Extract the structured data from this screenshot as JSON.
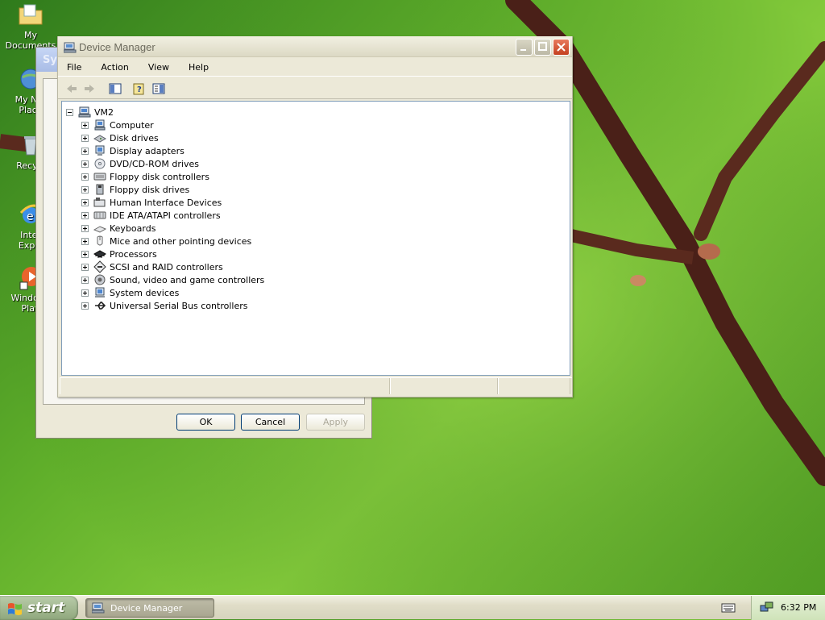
{
  "desktop": {
    "icons": [
      {
        "label": "My Documents"
      },
      {
        "label": "My Net\nPlace"
      },
      {
        "label": "Recycl"
      },
      {
        "label": "Inter\nExplo"
      },
      {
        "label": "Windows\nPlay"
      }
    ]
  },
  "background_window": {
    "title": "Sys",
    "buttons": {
      "ok": "OK",
      "cancel": "Cancel",
      "apply": "Apply"
    }
  },
  "device_manager": {
    "title": "Device Manager",
    "menu": [
      "File",
      "Action",
      "View",
      "Help"
    ],
    "toolbar": [
      "back-icon",
      "forward-icon",
      "show-hide-console-tree-icon",
      "help-icon",
      "properties-icon"
    ],
    "tree": {
      "root": "VM2",
      "items": [
        {
          "label": "Computer",
          "icon": "computer-icon"
        },
        {
          "label": "Disk drives",
          "icon": "disk-drive-icon"
        },
        {
          "label": "Display adapters",
          "icon": "display-adapter-icon"
        },
        {
          "label": "DVD/CD-ROM drives",
          "icon": "cdrom-icon"
        },
        {
          "label": "Floppy disk controllers",
          "icon": "floppy-controller-icon"
        },
        {
          "label": "Floppy disk drives",
          "icon": "floppy-drive-icon"
        },
        {
          "label": "Human Interface Devices",
          "icon": "hid-icon"
        },
        {
          "label": "IDE ATA/ATAPI controllers",
          "icon": "ide-controller-icon"
        },
        {
          "label": "Keyboards",
          "icon": "keyboard-icon"
        },
        {
          "label": "Mice and other pointing devices",
          "icon": "mouse-icon"
        },
        {
          "label": "Processors",
          "icon": "processor-icon"
        },
        {
          "label": "SCSI and RAID controllers",
          "icon": "scsi-icon"
        },
        {
          "label": "Sound, video and game controllers",
          "icon": "sound-icon"
        },
        {
          "label": "System devices",
          "icon": "system-devices-icon"
        },
        {
          "label": "Universal Serial Bus controllers",
          "icon": "usb-icon"
        }
      ]
    }
  },
  "taskbar": {
    "start_label": "start",
    "task_label": "Device Manager",
    "clock": "6:32 PM"
  },
  "colors": {
    "accent": "#3a6ea5",
    "taskbar": "#e0ddc8",
    "window_face": "#ece9d8"
  }
}
